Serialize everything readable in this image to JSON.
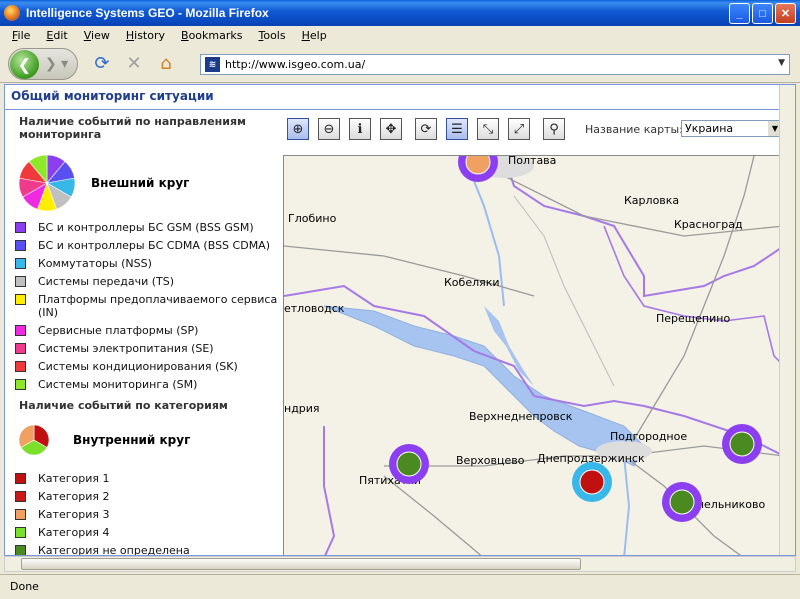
{
  "window": {
    "title": "Intelligence Systems GEO - Mozilla Firefox"
  },
  "menu": [
    "File",
    "Edit",
    "View",
    "History",
    "Bookmarks",
    "Tools",
    "Help"
  ],
  "nav": {
    "url": "http://www.isgeo.com.ua/"
  },
  "page": {
    "header": "Общий мониторинг ситуации",
    "legend1_title": "Наличие событий по направлениям мониторинга",
    "outer_circle_label": "Внешний круг",
    "directions": [
      {
        "label": "БС и контроллеры БС GSM (BSS GSM)",
        "color": "#8b3ff0"
      },
      {
        "label": "БС и контроллеры БС CDMA (BSS CDMA)",
        "color": "#5a4ff0"
      },
      {
        "label": "Коммутаторы (NSS)",
        "color": "#38b8e8"
      },
      {
        "label": "Системы передачи (TS)",
        "color": "#c0c0c0"
      },
      {
        "label": "Платформы предоплачиваемого сервиса (IN)",
        "color": "#ffee00"
      },
      {
        "label": "Сервисные платформы (SP)",
        "color": "#f02ae0"
      },
      {
        "label": "Системы электропитания (SE)",
        "color": "#f03a8c"
      },
      {
        "label": "Системы кондиционирования (SK)",
        "color": "#f03a3a"
      },
      {
        "label": "Системы мониторинга (SM)",
        "color": "#8ee82a"
      }
    ],
    "legend2_title": "Наличие событий по категориям",
    "inner_circle_label": "Внутренний круг",
    "categories": [
      {
        "label": "Категория 1",
        "color": "#c01010"
      },
      {
        "label": "Категория 2",
        "color": "#c81818"
      },
      {
        "label": "Категория 3",
        "color": "#f0a060"
      },
      {
        "label": "Категория 4",
        "color": "#7ae02a"
      },
      {
        "label": "Категория не определена",
        "color": "#4a8a20"
      }
    ],
    "map_name_label": "Название карты:",
    "map_name_value": "Украина"
  },
  "map": {
    "places": [
      "Полтава",
      "Карловка",
      "Глобино",
      "Красноград",
      "Кобеляки",
      "етловодск",
      "Перещепино",
      "ндрия",
      "Верхнеднепровск",
      "Подгородное",
      "Верховцево",
      "Днепродзержинск",
      "Пятихатки",
      "Синельниково"
    ],
    "markers": [
      {
        "outer": "#8b3ff0",
        "inner": "#f0a060"
      },
      {
        "outer": "#8b3ff0",
        "inner": "#4a8a20"
      },
      {
        "outer": "#38b8e8",
        "inner": "#c01010"
      },
      {
        "outer": "#8b3ff0",
        "inner": "#4a8a20"
      },
      {
        "outer": "#8b3ff0",
        "inner": "#4a8a20"
      }
    ]
  },
  "status": {
    "text": "Done"
  }
}
